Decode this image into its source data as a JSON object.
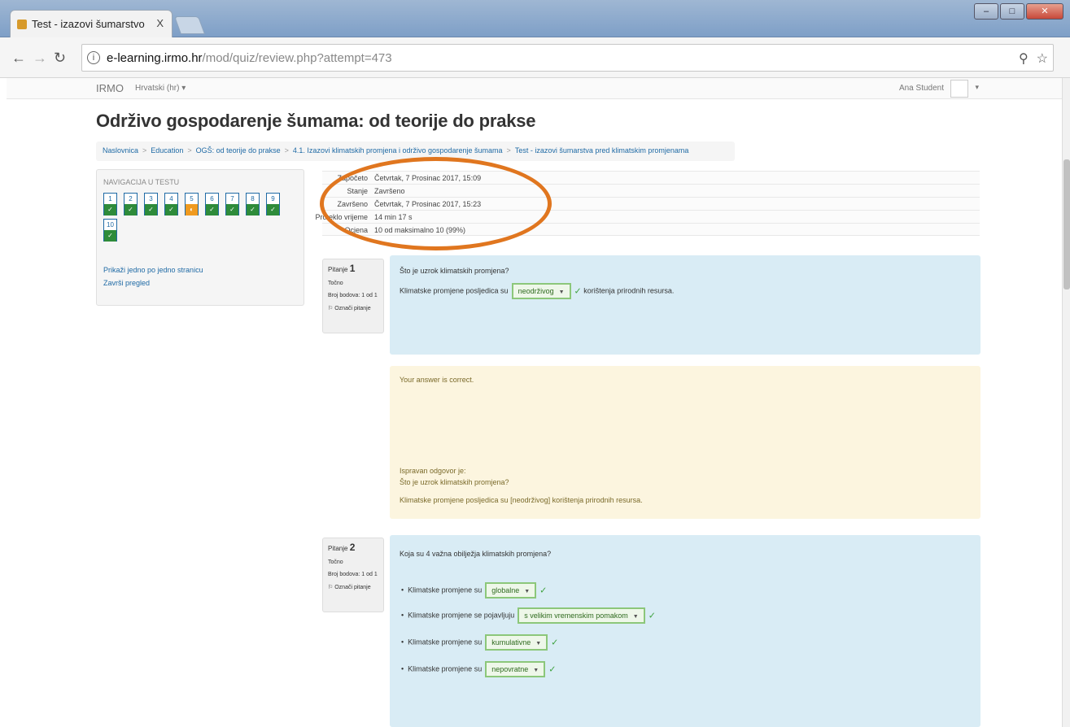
{
  "browser": {
    "tab_title": "Test - izazovi šumarstvo",
    "tab_close": "X",
    "url_host": "e-learning.irmo.hr",
    "url_path": "/mod/quiz/review.php?attempt=473"
  },
  "site": {
    "brand": "IRMO",
    "language": "Hrvatski (hr) ▾",
    "user": "Ana Student",
    "course_title": "Održivo gospodarenje šumama: od teorije do prakse",
    "breadcrumb": [
      "Naslovnica",
      "Education",
      "OGŠ: od teorije do prakse",
      "4.1. Izazovi klimatskih promjena i održivo gospodarenje šumama",
      "Test - izazovi šumarstva pred klimatskim promjenama"
    ]
  },
  "quiz_nav": {
    "title": "NAVIGACIJA U TESTU",
    "buttons": [
      {
        "n": "1",
        "state": "correct"
      },
      {
        "n": "2",
        "state": "correct"
      },
      {
        "n": "3",
        "state": "correct"
      },
      {
        "n": "4",
        "state": "correct"
      },
      {
        "n": "5",
        "state": "partial"
      },
      {
        "n": "6",
        "state": "correct"
      },
      {
        "n": "7",
        "state": "correct"
      },
      {
        "n": "8",
        "state": "correct"
      },
      {
        "n": "9",
        "state": "correct"
      },
      {
        "n": "10",
        "state": "correct"
      }
    ],
    "link_one_page": "Prikaži jedno po jedno stranicu",
    "link_finish": "Završi pregled"
  },
  "summary": {
    "rows": [
      {
        "label": "Započeto",
        "value": "Četvrtak, 7 Prosinac 2017, 15:09"
      },
      {
        "label": "Stanje",
        "value": "Završeno"
      },
      {
        "label": "Završeno",
        "value": "Četvrtak, 7 Prosinac 2017, 15:23"
      },
      {
        "label": "Proteklo vrijeme",
        "value": "14 min 17 s"
      },
      {
        "label": "Ocjena",
        "value": "10 od maksimalno 10 (99%)"
      }
    ]
  },
  "q1": {
    "number_prefix": "Pitanje",
    "number": "1",
    "status": "Točno",
    "points": "Broj bodova: 1 od 1",
    "flag": "Označi pitanje",
    "text": "Što je uzrok klimatskih promjena?",
    "sentence_before": "Klimatske promjene posljedica su",
    "selected": "neodrživog",
    "sentence_after": "korištenja prirodnih resursa.",
    "feedback": "Your answer is correct.",
    "correct_heading": "Ispravan odgovor je:",
    "correct_question": "Što je uzrok klimatskih promjena?",
    "correct_answer": "Klimatske promjene posljedica su [neodrživog] korištenja prirodnih resursa."
  },
  "q2": {
    "number_prefix": "Pitanje",
    "number": "2",
    "status": "Točno",
    "points": "Broj bodova: 1 od 1",
    "flag": "Označi pitanje",
    "text": "Koja su 4 važna obilježja klimatskih promjena?",
    "items": [
      {
        "before": "Klimatske promjene su",
        "selected": "globalne"
      },
      {
        "before": "Klimatske promjene se pojavljuju",
        "selected": "s velikim vremenskim pomakom"
      },
      {
        "before": "Klimatske promjene su",
        "selected": "kumulativne"
      },
      {
        "before": "Klimatske promjene su",
        "selected": "nepovratne"
      }
    ]
  },
  "colors": {
    "accent": "#e0761f",
    "correct": "#2e8b3a",
    "partial": "#f09a1f",
    "question_bg": "#d9ecf5",
    "feedback_bg": "#fcf5df"
  }
}
